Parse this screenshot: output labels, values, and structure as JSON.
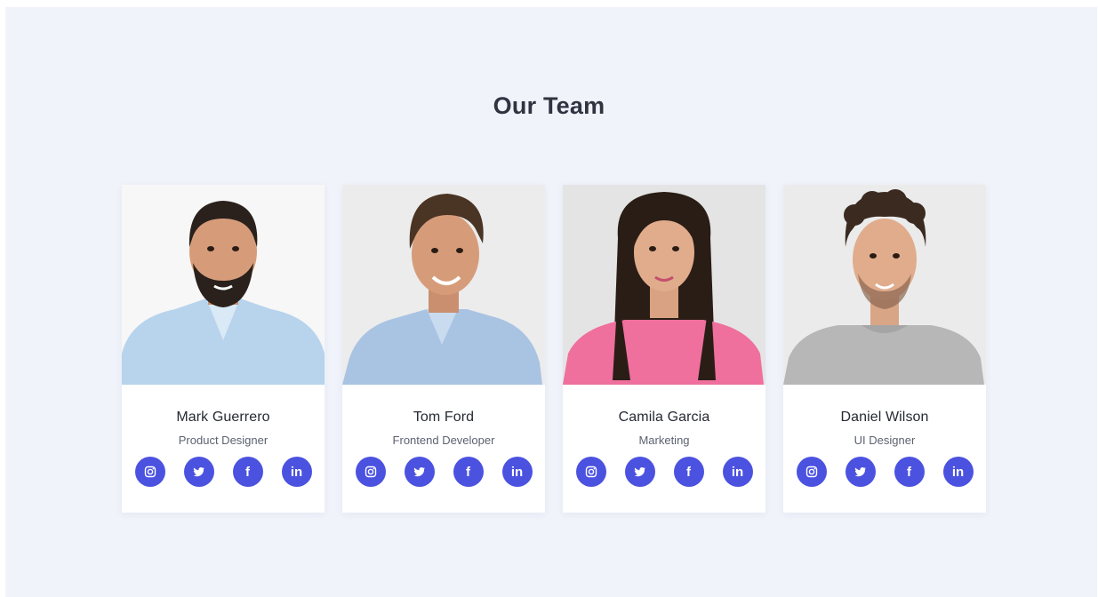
{
  "section": {
    "title": "Our Team"
  },
  "colors": {
    "accent": "#4b52e0",
    "background": "#f1f3fb",
    "card": "#ffffff"
  },
  "members": [
    {
      "name": "Mark Guerrero",
      "role": "Product Designer",
      "photo_desc": "man-dark-beard-light-blue-shirt"
    },
    {
      "name": "Tom Ford",
      "role": "Frontend Developer",
      "photo_desc": "man-smiling-blue-shirt"
    },
    {
      "name": "Camila Garcia",
      "role": "Marketing",
      "photo_desc": "woman-long-dark-hair-pink-sweater"
    },
    {
      "name": "Daniel Wilson",
      "role": "UI Designer",
      "photo_desc": "man-curly-hair-grey-tshirt"
    }
  ],
  "social_icons": [
    {
      "icon": "instagram-icon",
      "glyph": ""
    },
    {
      "icon": "twitter-icon",
      "glyph": ""
    },
    {
      "icon": "facebook-icon",
      "glyph": "f"
    },
    {
      "icon": "linkedin-icon",
      "glyph": "in"
    }
  ]
}
